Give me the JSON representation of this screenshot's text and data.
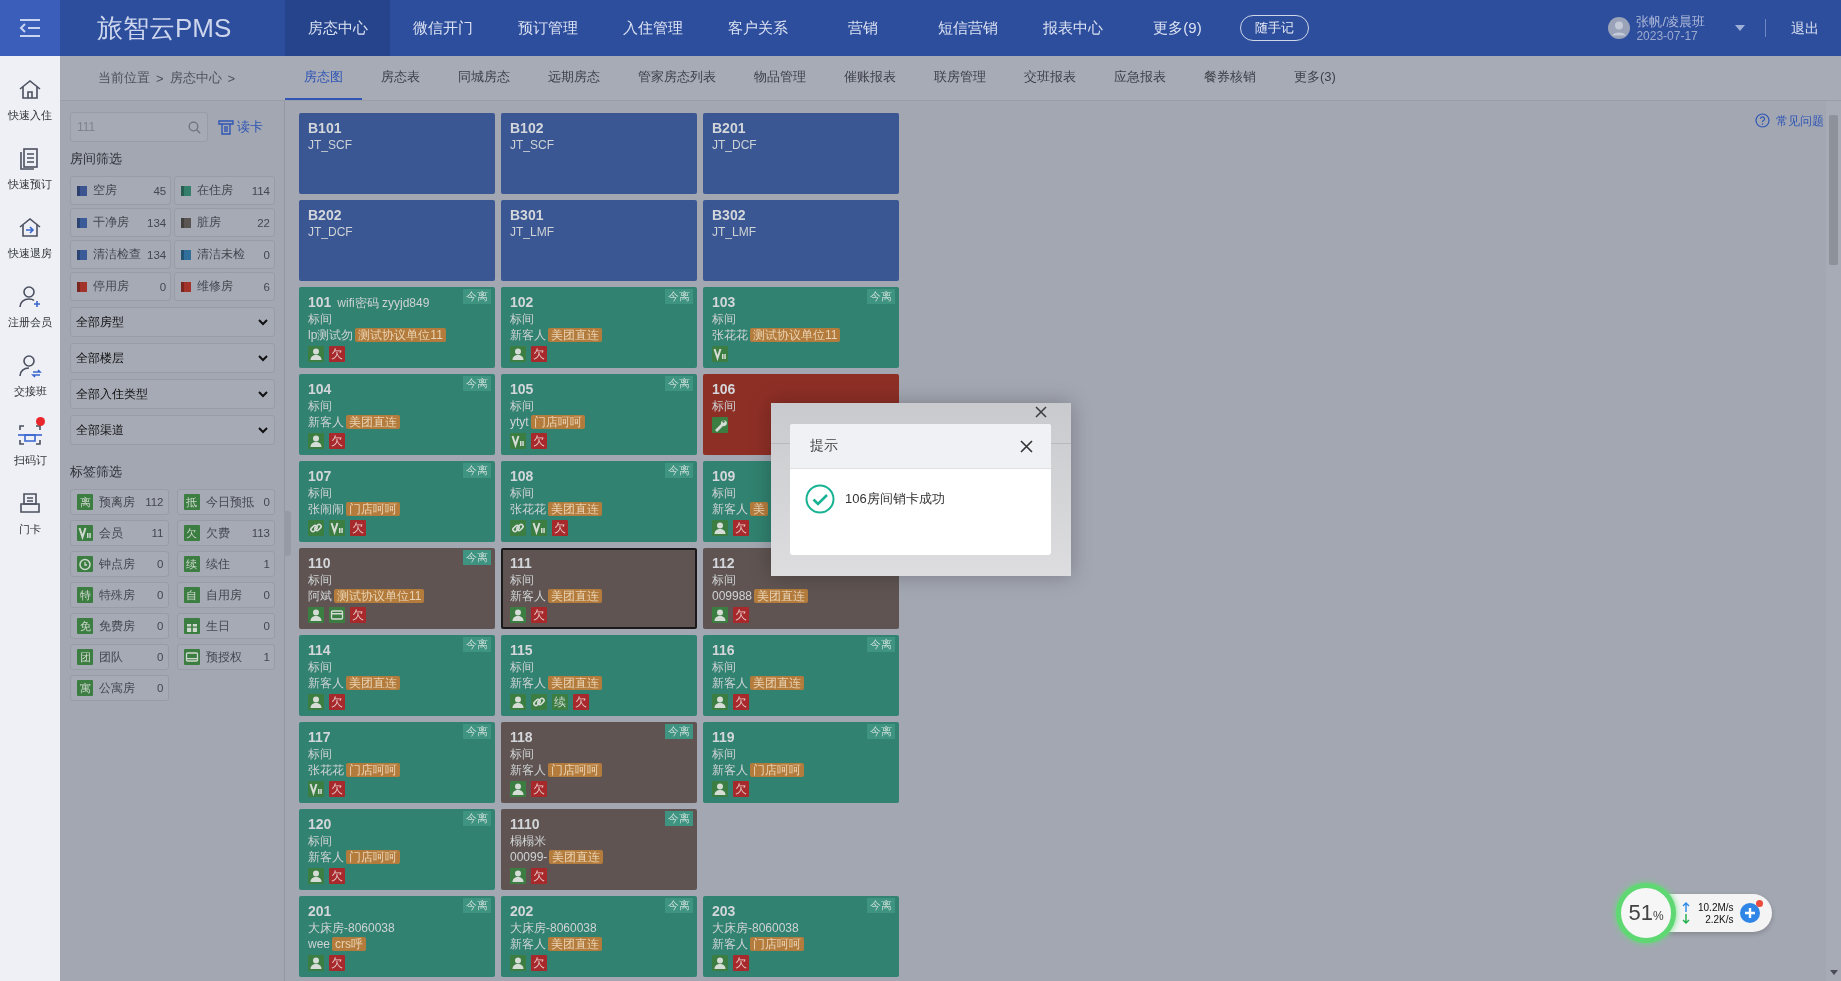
{
  "header": {
    "logo": "旅智云PMS",
    "nav": [
      {
        "label": "房态中心",
        "selected": true
      },
      {
        "label": "微信开门",
        "selected": false
      },
      {
        "label": "预订管理",
        "selected": false
      },
      {
        "label": "入住管理",
        "selected": false
      },
      {
        "label": "客户关系",
        "selected": false
      },
      {
        "label": "营销",
        "selected": false
      },
      {
        "label": "短信营销",
        "selected": false
      },
      {
        "label": "报表中心",
        "selected": false
      },
      {
        "label": "更多(9)",
        "selected": false
      }
    ],
    "note_button": "随手记",
    "user": {
      "name": "张帆/凌晨班",
      "date": "2023-07-17"
    },
    "logout": "退出"
  },
  "quick_actions": [
    {
      "label": "快速入住",
      "kind": "house",
      "alert": false
    },
    {
      "label": "快速预订",
      "kind": "document",
      "alert": false
    },
    {
      "label": "快速退房",
      "kind": "checkout",
      "alert": false
    },
    {
      "label": "注册会员",
      "kind": "member",
      "alert": false
    },
    {
      "label": "交接班",
      "kind": "handover",
      "alert": false
    },
    {
      "label": "扫码订",
      "kind": "scan",
      "alert": true
    },
    {
      "label": "门卡",
      "kind": "printer",
      "alert": false
    }
  ],
  "breadcrumb": [
    "当前位置",
    ">",
    "房态中心",
    ">"
  ],
  "tabs": [
    {
      "label": "房态图",
      "selected": true
    },
    {
      "label": "房态表",
      "selected": false
    },
    {
      "label": "同城房态",
      "selected": false
    },
    {
      "label": "远期房态",
      "selected": false
    },
    {
      "label": "管家房态列表",
      "selected": false
    },
    {
      "label": "物品管理",
      "selected": false
    },
    {
      "label": "催账报表",
      "selected": false
    },
    {
      "label": "联房管理",
      "selected": false
    },
    {
      "label": "交班报表",
      "selected": false
    },
    {
      "label": "应急报表",
      "selected": false
    },
    {
      "label": "餐券核销",
      "selected": false
    },
    {
      "label": "更多(3)",
      "selected": false
    }
  ],
  "filters": {
    "search": {
      "value": "111"
    },
    "read_card": "读卡",
    "room_title": "房间筛选",
    "room_filters": [
      {
        "label": "空房",
        "count": "45",
        "color": "#3c5590"
      },
      {
        "label": "在住房",
        "count": "114",
        "color": "#347e6c"
      },
      {
        "label": "干净房",
        "count": "134",
        "color": "#3a5b98"
      },
      {
        "label": "脏房",
        "count": "22",
        "color": "#5a5452"
      },
      {
        "label": "清洁检查",
        "count": "134",
        "color": "#3a5b98"
      },
      {
        "label": "清洁未检",
        "count": "0",
        "color": "#2f6f9a"
      },
      {
        "label": "停用房",
        "count": "0",
        "color": "#a3322a"
      },
      {
        "label": "维修房",
        "count": "6",
        "color": "#a3322b"
      }
    ],
    "dropdowns": [
      "全部房型",
      "全部楼层",
      "全部入住类型",
      "全部渠道"
    ],
    "tag_title": "标签筛选",
    "tag_filters": [
      {
        "label": "预离房",
        "count": "112",
        "mark": "离"
      },
      {
        "label": "今日预抵",
        "count": "0",
        "mark": "抵"
      },
      {
        "label": "会员",
        "count": "11",
        "kind": "vip"
      },
      {
        "label": "欠费",
        "count": "113",
        "mark": "欠"
      },
      {
        "label": "钟点房",
        "count": "0",
        "kind": "clock"
      },
      {
        "label": "续住",
        "count": "1",
        "mark": "续"
      },
      {
        "label": "特殊房",
        "count": "0",
        "mark": "特"
      },
      {
        "label": "自用房",
        "count": "0",
        "mark": "自"
      },
      {
        "label": "免费房",
        "count": "0",
        "mark": "免"
      },
      {
        "label": "生日",
        "count": "0",
        "kind": "gift"
      },
      {
        "label": "团队",
        "count": "0",
        "mark": "团"
      },
      {
        "label": "预授权",
        "count": "1",
        "kind": "card"
      },
      {
        "label": "公寓房",
        "count": "0",
        "mark": "寓"
      }
    ]
  },
  "help": "常见问题",
  "room_rows": [
    [
      {
        "room": "B101",
        "type": "JT_SCF",
        "kind": "vacant",
        "selected": false
      },
      {
        "room": "B102",
        "type": "JT_SCF",
        "kind": "vacant",
        "selected": false
      },
      {
        "room": "B201",
        "type": "JT_DCF",
        "kind": "vacant",
        "selected": false
      }
    ],
    [
      {
        "room": "B202",
        "type": "JT_DCF",
        "kind": "vacant",
        "selected": false
      },
      {
        "room": "B301",
        "type": "JT_LMF",
        "kind": "vacant",
        "selected": false
      },
      {
        "room": "B302",
        "type": "JT_LMF",
        "kind": "vacant",
        "selected": false
      }
    ],
    [
      {
        "room": "101",
        "note": "wifi密码 zyyjd849",
        "type": "标间",
        "guest": "lp测试勿",
        "source": "测试协议单位11",
        "kind": "occupied",
        "selected": false,
        "leave_label": "今离",
        "marks": [
          {
            "kind": "guest"
          },
          {
            "kind": "debt",
            "text": "欠"
          }
        ]
      },
      {
        "room": "102",
        "type": "标间",
        "guest": "新客人",
        "source": "美团直连",
        "kind": "occupied",
        "selected": false,
        "leave_label": "今离",
        "marks": [
          {
            "kind": "guest"
          },
          {
            "kind": "debt",
            "text": "欠"
          }
        ]
      },
      {
        "room": "103",
        "type": "标间",
        "guest": "张花花",
        "source": "测试协议单位11",
        "kind": "occupied",
        "selected": false,
        "leave_label": "今离",
        "marks": [
          {
            "kind": "vip"
          }
        ]
      }
    ],
    [
      {
        "room": "104",
        "type": "标间",
        "guest": "新客人",
        "source": "美团直连",
        "kind": "occupied",
        "selected": false,
        "leave_label": "今离",
        "marks": [
          {
            "kind": "guest"
          },
          {
            "kind": "debt",
            "text": "欠"
          }
        ]
      },
      {
        "room": "105",
        "type": "标间",
        "guest": "ytyt",
        "source": "门店呵呵",
        "kind": "occupied",
        "selected": false,
        "leave_label": "今离",
        "marks": [
          {
            "kind": "vip"
          },
          {
            "kind": "debt",
            "text": "欠"
          }
        ]
      },
      {
        "room": "106",
        "type": "标间",
        "kind": "repair",
        "selected": false,
        "marks": [
          {
            "kind": "repair"
          }
        ]
      }
    ],
    [
      {
        "room": "107",
        "type": "标间",
        "guest": "张闹闹",
        "source": "门店呵呵",
        "kind": "occupied",
        "selected": false,
        "leave_label": "今离",
        "marks": [
          {
            "kind": "link"
          },
          {
            "kind": "vip"
          },
          {
            "kind": "debt",
            "text": "欠"
          }
        ]
      },
      {
        "room": "108",
        "type": "标间",
        "guest": "张花花",
        "source": "美团直连",
        "kind": "occupied",
        "selected": false,
        "leave_label": "今离",
        "marks": [
          {
            "kind": "link"
          },
          {
            "kind": "vip"
          },
          {
            "kind": "debt",
            "text": "欠"
          }
        ]
      },
      {
        "room": "109",
        "type": "标间",
        "guest": "新客人",
        "source": "美",
        "kind": "occupied",
        "selected": false,
        "marks": [
          {
            "kind": "guest"
          },
          {
            "kind": "debt",
            "text": "欠"
          }
        ]
      }
    ],
    [
      {
        "room": "110",
        "type": "标间",
        "guest": "阿斌",
        "source": "测试协议单位11",
        "kind": "dirty",
        "selected": false,
        "leave_label": "今离",
        "marks": [
          {
            "kind": "guest"
          },
          {
            "kind": "card"
          },
          {
            "kind": "debt",
            "text": "欠"
          }
        ]
      },
      {
        "room": "111",
        "type": "标间",
        "guest": "新客人",
        "source": "美团直连",
        "kind": "dirty",
        "selected": true,
        "marks": [
          {
            "kind": "guest"
          },
          {
            "kind": "debt",
            "text": "欠"
          }
        ]
      },
      {
        "room": "112",
        "type": "标间",
        "guest": "009988",
        "source": "美团直连",
        "kind": "dirty",
        "selected": false,
        "marks": [
          {
            "kind": "guest"
          },
          {
            "kind": "debt",
            "text": "欠"
          }
        ]
      }
    ],
    [
      {
        "room": "114",
        "type": "标间",
        "guest": "新客人",
        "source": "美团直连",
        "kind": "occupied",
        "selected": false,
        "leave_label": "今离",
        "marks": [
          {
            "kind": "guest"
          },
          {
            "kind": "debt",
            "text": "欠"
          }
        ]
      },
      {
        "room": "115",
        "type": "标间",
        "guest": "新客人",
        "source": "美团直连",
        "kind": "occupied",
        "selected": false,
        "marks": [
          {
            "kind": "guest"
          },
          {
            "kind": "link"
          },
          {
            "kind": "renew",
            "text": "续"
          },
          {
            "kind": "debt",
            "text": "欠"
          }
        ]
      },
      {
        "room": "116",
        "type": "标间",
        "guest": "新客人",
        "source": "美团直连",
        "kind": "occupied",
        "selected": false,
        "leave_label": "今离",
        "marks": [
          {
            "kind": "guest"
          },
          {
            "kind": "debt",
            "text": "欠"
          }
        ]
      }
    ],
    [
      {
        "room": "117",
        "type": "标间",
        "guest": "张花花",
        "source": "门店呵呵",
        "kind": "occupied",
        "selected": false,
        "leave_label": "今离",
        "marks": [
          {
            "kind": "vip"
          },
          {
            "kind": "debt",
            "text": "欠"
          }
        ]
      },
      {
        "room": "118",
        "type": "标间",
        "guest": "新客人",
        "source": "门店呵呵",
        "kind": "dirty",
        "selected": false,
        "leave_label": "今离",
        "marks": [
          {
            "kind": "guest"
          },
          {
            "kind": "debt",
            "text": "欠"
          }
        ]
      },
      {
        "room": "119",
        "type": "标间",
        "guest": "新客人",
        "source": "门店呵呵",
        "kind": "occupied",
        "selected": false,
        "leave_label": "今离",
        "marks": [
          {
            "kind": "guest"
          },
          {
            "kind": "debt",
            "text": "欠"
          }
        ]
      }
    ],
    [
      {
        "room": "120",
        "type": "标间",
        "guest": "新客人",
        "source": "门店呵呵",
        "kind": "occupied",
        "selected": false,
        "leave_label": "今离",
        "marks": [
          {
            "kind": "guest"
          },
          {
            "kind": "debt",
            "text": "欠"
          }
        ]
      },
      {
        "room": "1110",
        "type": "榻榻米",
        "guest": "00099-",
        "source": "美团直连",
        "kind": "dirty",
        "selected": false,
        "leave_label": "今离",
        "marks": [
          {
            "kind": "guest"
          },
          {
            "kind": "debt",
            "text": "欠"
          }
        ]
      }
    ],
    [
      {
        "room": "201",
        "type": "大床房-8060038",
        "guest": "wee",
        "source": "crs呼",
        "kind": "occupied",
        "selected": false,
        "leave_label": "今离",
        "marks": [
          {
            "kind": "guest"
          },
          {
            "kind": "debt",
            "text": "欠"
          }
        ]
      },
      {
        "room": "202",
        "type": "大床房-8060038",
        "guest": "新客人",
        "source": "美团直连",
        "kind": "occupied",
        "selected": false,
        "leave_label": "今离",
        "marks": [
          {
            "kind": "guest"
          },
          {
            "kind": "debt",
            "text": "欠"
          }
        ]
      },
      {
        "room": "203",
        "type": "大床房-8060038",
        "guest": "新客人",
        "source": "门店呵呵",
        "kind": "occupied",
        "selected": false,
        "leave_label": "今离",
        "marks": [
          {
            "kind": "guest"
          },
          {
            "kind": "debt",
            "text": "欠"
          }
        ]
      }
    ]
  ],
  "dialog": {
    "title": "提示",
    "message": "106房间销卡成功"
  },
  "net_widget": {
    "percent": "51",
    "unit": "%",
    "upload": "10.2M/s",
    "download": "2.2K/s",
    "alert": true
  }
}
